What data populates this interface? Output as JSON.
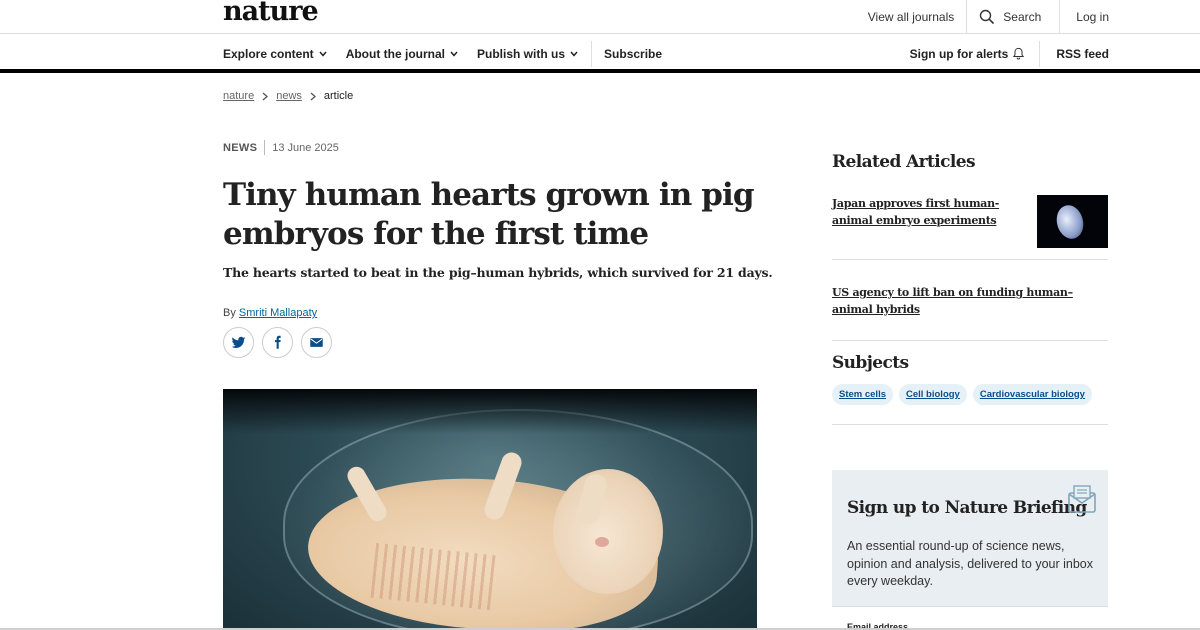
{
  "header": {
    "logo": "nature",
    "view_all": "View all journals",
    "search": "Search",
    "login": "Log in"
  },
  "nav": {
    "explore": "Explore content",
    "about": "About the journal",
    "publish": "Publish with us",
    "subscribe": "Subscribe",
    "alerts": "Sign up for alerts",
    "rss": "RSS feed"
  },
  "breadcrumb": {
    "items": [
      "nature",
      "news",
      "article"
    ]
  },
  "article": {
    "type": "NEWS",
    "date": "13 June 2025",
    "title": "Tiny human hearts grown in pig embryos for the first time",
    "standfirst": "The hearts started to beat in the pig–human hybrids, which survived for 21 days.",
    "by": "By",
    "author": "Smriti Mallapaty"
  },
  "related": {
    "heading": "Related Articles",
    "items": [
      "Japan approves first human-animal embryo experiments",
      "US agency to lift ban on funding human–animal hybrids"
    ]
  },
  "subjects": {
    "heading": "Subjects",
    "tags": [
      "Stem cells",
      "Cell biology",
      "Cardiovascular biology"
    ]
  },
  "briefing": {
    "heading": "Sign up to Nature Briefing",
    "text": "An essential round-up of science news, opinion and analysis, delivered to your inbox every weekday.",
    "email_label": "Email address"
  },
  "icons": [
    "search-icon",
    "chevron-down-icon",
    "bell-icon",
    "twitter-icon",
    "facebook-icon",
    "email-icon",
    "newsletter-icon"
  ]
}
